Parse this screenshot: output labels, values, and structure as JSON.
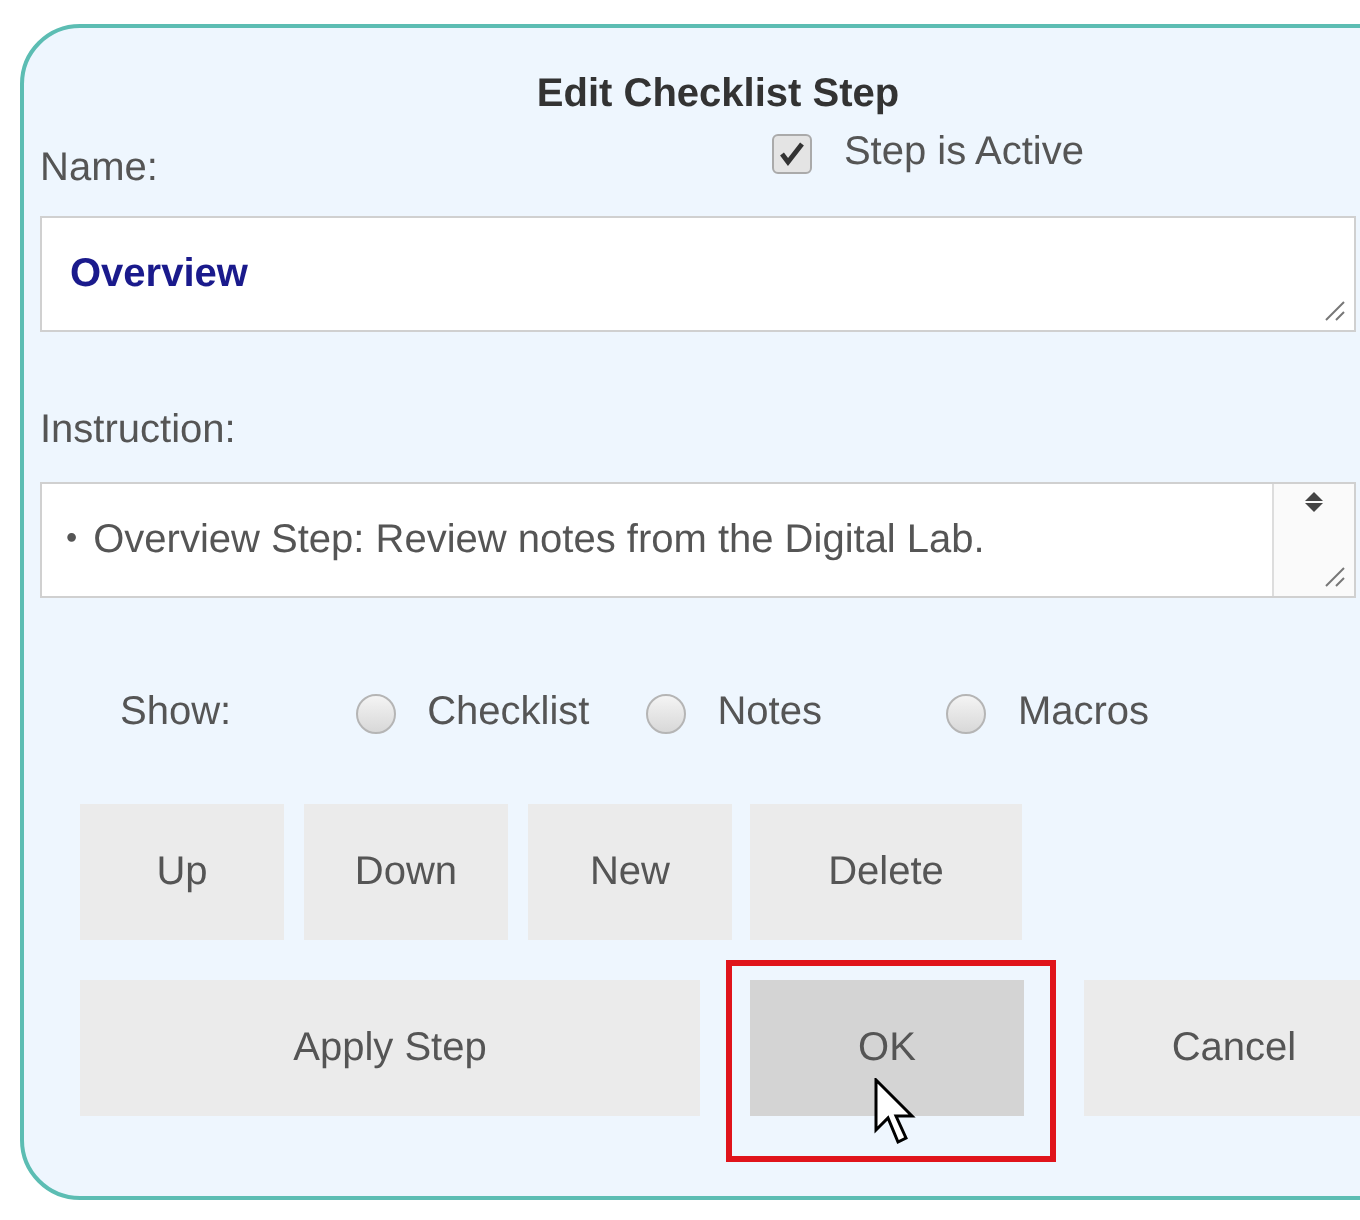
{
  "dialog": {
    "title": "Edit Checklist Step"
  },
  "active_checkbox": {
    "label": "Step is Active",
    "checked": true
  },
  "name_field": {
    "label": "Name:",
    "value": "Overview"
  },
  "instruction_field": {
    "label": "Instruction:",
    "bullet": "•",
    "value": "Overview Step: Review notes from the Digital Lab."
  },
  "show": {
    "label": "Show:",
    "options": [
      {
        "label": "Checklist",
        "selected": false
      },
      {
        "label": "Notes",
        "selected": false
      },
      {
        "label": "Macros",
        "selected": false
      }
    ]
  },
  "step_buttons": [
    {
      "label": "Up"
    },
    {
      "label": "Down"
    },
    {
      "label": "New"
    },
    {
      "label": "Delete"
    }
  ],
  "action_buttons": [
    {
      "label": "Apply Step",
      "highlighted": false
    },
    {
      "label": "OK",
      "highlighted": true
    },
    {
      "label": "Cancel",
      "highlighted": false
    }
  ]
}
